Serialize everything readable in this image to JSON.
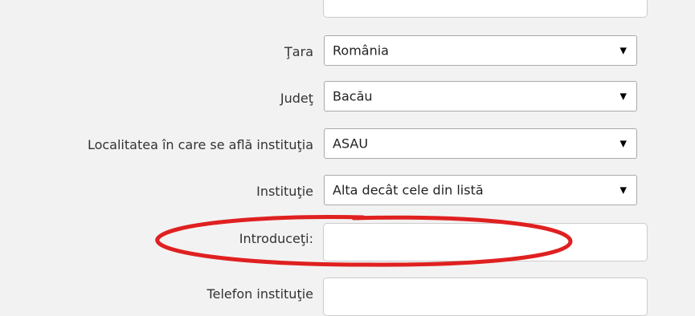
{
  "form": {
    "country": {
      "label": "Ţara",
      "value": "România"
    },
    "county": {
      "label": "Judeţ",
      "value": "Bacău"
    },
    "locality": {
      "label": "Localitatea în care se află instituţia",
      "value": "ASAU"
    },
    "institution": {
      "label": "Instituţie",
      "value": "Alta decât cele din listă"
    },
    "enter_field": {
      "label": "Introduceţi:",
      "value": ""
    },
    "phone": {
      "label": "Telefon instituţie",
      "value": ""
    }
  },
  "icons": {
    "dropdown_arrow": "triangle-down",
    "glyph": "▼"
  },
  "annotation": {
    "shape": "ellipse",
    "color": "#e02020"
  }
}
